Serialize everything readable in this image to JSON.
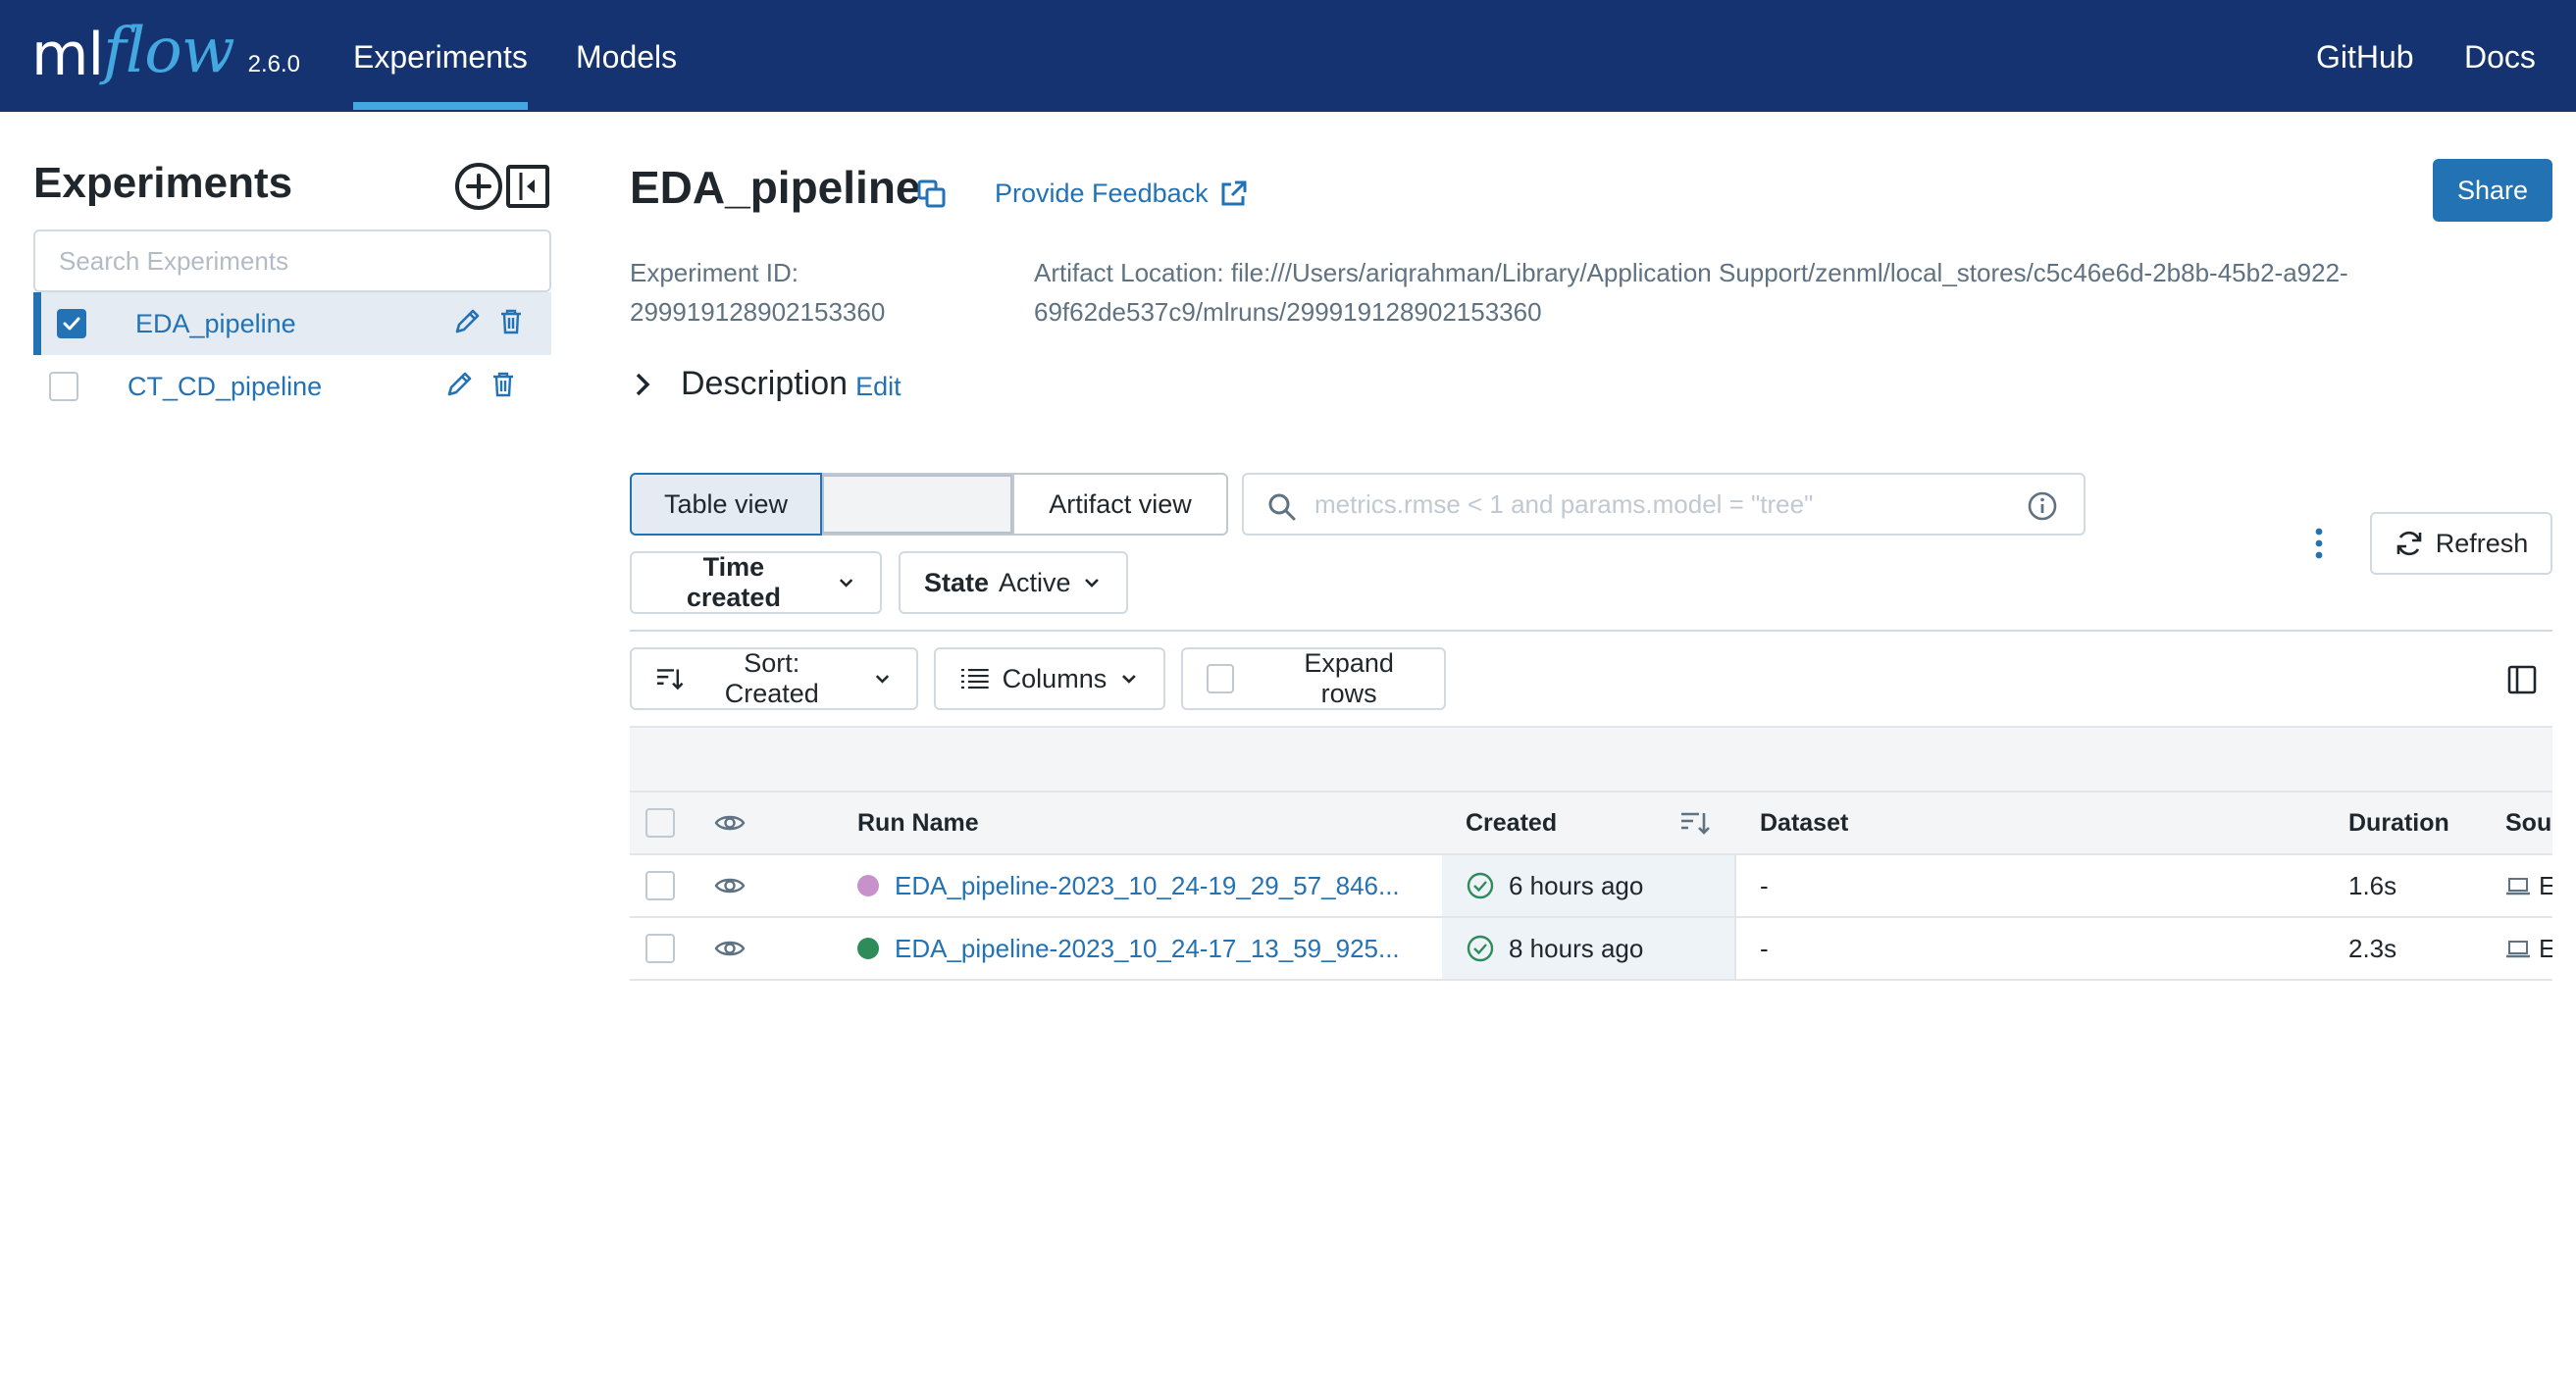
{
  "header": {
    "logo_ml": "ml",
    "logo_flow": "flow",
    "version": "2.6.0",
    "nav": [
      {
        "label": "Experiments",
        "active": true
      },
      {
        "label": "Models",
        "active": false
      }
    ],
    "links": [
      {
        "label": "GitHub"
      },
      {
        "label": "Docs"
      }
    ],
    "colors": {
      "bar": "#143370",
      "accent": "#43a7e0"
    }
  },
  "sidebar": {
    "title": "Experiments",
    "search_placeholder": "Search Experiments",
    "add_icon": "plus-circle-icon",
    "collapse_icon": "collapse-sidebar-icon",
    "items": [
      {
        "name": "EDA_pipeline",
        "checked": true,
        "selected": true
      },
      {
        "name": "CT_CD_pipeline",
        "checked": false,
        "selected": false
      }
    ]
  },
  "experiment": {
    "title": "EDA_pipeline",
    "feedback_label": "Provide Feedback",
    "share_label": "Share",
    "id_label": "Experiment ID:",
    "id_value": "299919128902153360",
    "artifact_line1": "Artifact Location: file:///Users/ariqrahman/Library/Application Support/zenml/local_stores/c5c46e6d-2b8b-45b2-a922-",
    "artifact_line2": "69f62de537c9/mlruns/299919128902153360",
    "description_label": "Description",
    "description_edit": "Edit"
  },
  "controls": {
    "table_view": "Table view",
    "artifact_view": "Artifact view",
    "search_placeholder": "metrics.rmse < 1 and params.model = \"tree\"",
    "time_created": "Time created",
    "state_label": "State",
    "state_value": "Active",
    "refresh": "Refresh",
    "sort": "Sort: Created",
    "columns": "Columns",
    "expand_rows": "Expand rows"
  },
  "table": {
    "headers": {
      "run_name": "Run Name",
      "created": "Created",
      "dataset": "Dataset",
      "duration": "Duration",
      "source": "Sou"
    },
    "rows": [
      {
        "run_name": "EDA_pipeline-2023_10_24-19_29_57_846...",
        "created": "6 hours ago",
        "dataset": "-",
        "duration": "1.6s",
        "source": "E",
        "dot_color": "#c792c9"
      },
      {
        "run_name": "EDA_pipeline-2023_10_24-17_13_59_925...",
        "created": "8 hours ago",
        "dataset": "-",
        "duration": "2.3s",
        "source": "E",
        "dot_color": "#2d8c5a"
      }
    ]
  }
}
